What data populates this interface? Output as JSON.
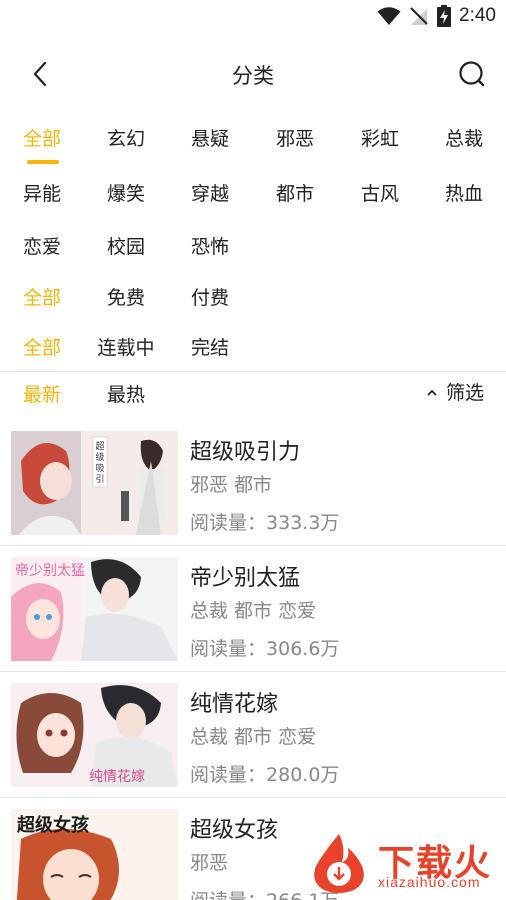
{
  "status_bar": {
    "time": "2:40"
  },
  "header": {
    "title": "分类"
  },
  "filters": {
    "genres_row1": [
      "全部",
      "玄幻",
      "悬疑",
      "邪恶",
      "彩虹",
      "总裁"
    ],
    "genres_row2": [
      "异能",
      "爆笑",
      "穿越",
      "都市",
      "古风",
      "热血"
    ],
    "genres_row3": [
      "恋爱",
      "校园",
      "恐怖"
    ],
    "price": [
      "全部",
      "免费",
      "付费"
    ],
    "status": [
      "全部",
      "连载中",
      "完结"
    ]
  },
  "sort": {
    "newest": "最新",
    "hottest": "最热",
    "filter_label": "筛选"
  },
  "reads_label": "阅读量：",
  "comics": [
    {
      "title": "超级吸引力",
      "tags": "邪恶 都市",
      "reads": "333.3万",
      "cover_text": "超级吸引力"
    },
    {
      "title": "帝少别太猛",
      "tags": "总裁 都市 恋爱",
      "reads": "306.6万",
      "cover_text": "帝少别太猛"
    },
    {
      "title": "纯情花嫁",
      "tags": "总裁 都市 恋爱",
      "reads": "280.0万",
      "cover_text": "纯情花嫁"
    },
    {
      "title": "超级女孩",
      "tags": "邪恶",
      "reads": "266.1万",
      "cover_text": "超级女孩"
    }
  ],
  "watermark": {
    "brand": "下载火",
    "url": "xiazaihuo.com"
  },
  "colors": {
    "accent": "#f5b50a",
    "text": "#222222",
    "secondary": "#888888",
    "watermark": "#e8432a"
  }
}
